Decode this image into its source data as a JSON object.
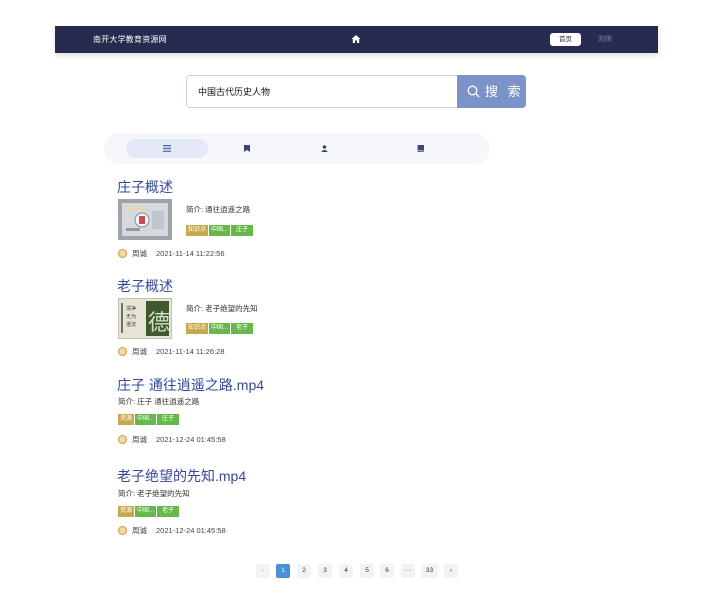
{
  "nav": {
    "brand": "南开大学教育资源网",
    "home_label": "首页",
    "user": "刘帅"
  },
  "search": {
    "query": "中国古代历史人物",
    "button_label": "搜 索"
  },
  "tabs": [
    {
      "icon": "list-icon",
      "active": true
    },
    {
      "icon": "bookmark-icon",
      "active": false
    },
    {
      "icon": "person-icon",
      "active": false
    },
    {
      "icon": "book-icon",
      "active": false
    }
  ],
  "results": [
    {
      "title": "庄子概述",
      "desc": "简介: 通往逍遥之路",
      "tags": [
        "知识点",
        "中国...",
        "庄子"
      ],
      "author": "周诚",
      "time": "2021-11-14 11:22:56"
    },
    {
      "title": "老子概述",
      "desc": "简介: 老子绝望的先知",
      "tags": [
        "知识点",
        "中国...",
        "老子"
      ],
      "author": "周诚",
      "time": "2021-11-14 11:26:28"
    },
    {
      "title": "庄子 通往逍遥之路.mp4",
      "desc": "简介: 庄子 通往逍遥之路",
      "tags": [
        "资源",
        "中国...",
        "庄子"
      ],
      "author": "周诚",
      "time": "2021-12-24 01:45:58"
    },
    {
      "title": "老子绝望的先知.mp4",
      "desc": "简介: 老子绝望的先知",
      "tags": [
        "资源",
        "中国...",
        "老子"
      ],
      "author": "周诚",
      "time": "2021-12-24 01:45:58"
    }
  ],
  "pagination": {
    "prev": "‹",
    "pages": [
      "1",
      "2",
      "3",
      "4",
      "5",
      "6",
      "···",
      "33"
    ],
    "next": "›",
    "current": "1"
  },
  "colors": {
    "navbar": "#262b4f",
    "accent": "#35489a",
    "search_button": "#7b93c9",
    "tag_yellow": "#c6a94f",
    "tag_green": "#67b84b",
    "page_active": "#4b8fd6"
  }
}
